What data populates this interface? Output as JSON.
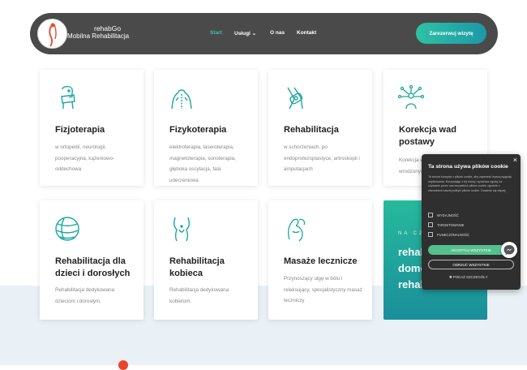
{
  "header": {
    "brand_top": "rehabGo",
    "brand_bottom": "Mobilna Rehabilitacja",
    "nav": [
      {
        "label": "Start"
      },
      {
        "label": "Usługi"
      },
      {
        "label": "O nas"
      },
      {
        "label": "Kontakt"
      }
    ],
    "cta": "Zarezerwuj wizytę"
  },
  "cards": [
    {
      "title": "Fizjoterapia",
      "text": "w ortopedii, neurologii, pooperacyjna, kążeniowo-oddechowa",
      "icon": "neck-brace-icon"
    },
    {
      "title": "Fizykoterapia",
      "text": "elektroterapia, laseroterapia, magnetoterapia, sonoterapia, głęboka oscylacja, fala uderzeniowa",
      "icon": "back-spine-icon"
    },
    {
      "title": "Rehabilitacja",
      "text": "w schorzeniach, po endoprotezoplastyce, artroskopii i amputacjach",
      "icon": "knee-brace-icon"
    },
    {
      "title": "Korekcja wad postawy",
      "text": "Korekcja wad postawy, nabytych i wrodzonych",
      "icon": "posture-nodes-icon"
    },
    {
      "title": "Rehabilitacja dla dzieci i dorosłych",
      "text": "Rehabilitacja dedykowana dzieciom i dorosłym.",
      "icon": "exercise-ball-icon"
    },
    {
      "title": "Rehabilitacja kobieca",
      "text": "Rehabilitacja dedykowana kobietom.",
      "icon": "female-pelvis-icon"
    },
    {
      "title": "Masaże lecznicze",
      "text": "Przynoszący ulgę w bólu i relaksujący, specjalistyczny masaż leczniczy",
      "icon": "massage-hand-icon"
    }
  ],
  "teal_card": {
    "kicker": "NA CZ",
    "line1": "rehab",
    "line2": "domo",
    "line3": "rehab"
  },
  "cookie": {
    "close": "×",
    "title": "Ta strona używa plików cookie",
    "desc": "Ta strona korzysta z plików cookie, aby zapewnić lepszą wygodę użytkowania. Korzystając z tej strony, wyrażasz zgodę na używanie przez nas wszystkich plików cookie zgodnie z warunkami naszej polityki plików cookie. Dowiedz się więcej",
    "options": [
      "WYDAJNOŚĆ",
      "TARGETOWANIE",
      "FUNKCJONALNOŚĆ"
    ],
    "accept": "AKCEPTUJ WSZYSTKIE",
    "reject": "ODRZUĆ WSZYSTKIE",
    "details": "POKAŻ SZCZEGÓŁY"
  },
  "colors": {
    "accent": "#2fc1a4",
    "header_bg": "#4a4a4a",
    "icon": "#1aa8a0"
  }
}
